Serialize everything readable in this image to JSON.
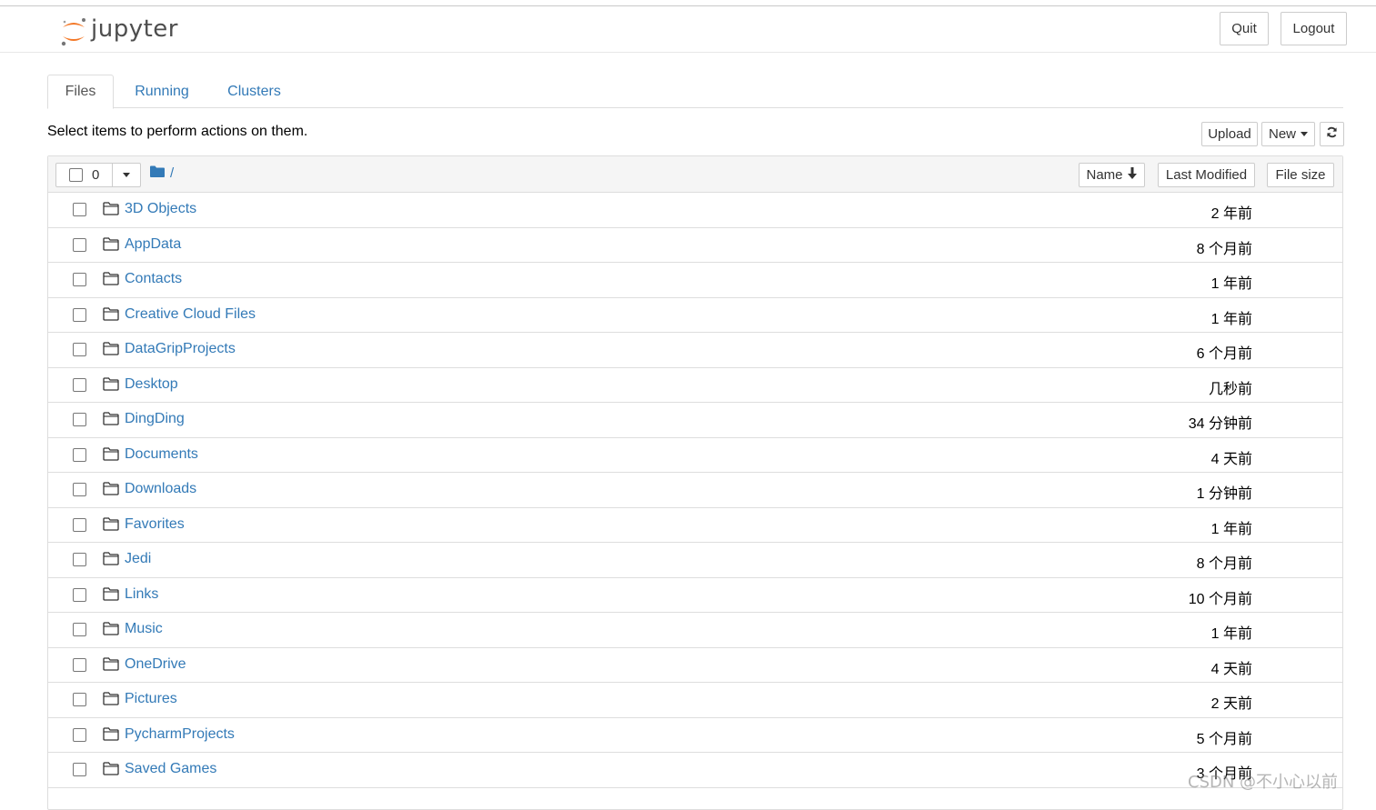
{
  "app": {
    "logo_text": "jupyter",
    "quit_label": "Quit",
    "logout_label": "Logout"
  },
  "tabs": [
    {
      "label": "Files"
    },
    {
      "label": "Running"
    },
    {
      "label": "Clusters"
    }
  ],
  "toolbar": {
    "hint": "Select items to perform actions on them.",
    "upload_label": "Upload",
    "new_label": "New"
  },
  "list": {
    "selected_count": "0",
    "breadcrumb": "/",
    "sort_name": "Name",
    "sort_modified": "Last Modified",
    "sort_size": "File size",
    "items": [
      {
        "name": "3D Objects",
        "modified": "2 年前"
      },
      {
        "name": "AppData",
        "modified": "8 个月前"
      },
      {
        "name": "Contacts",
        "modified": "1 年前"
      },
      {
        "name": "Creative Cloud Files",
        "modified": "1 年前"
      },
      {
        "name": "DataGripProjects",
        "modified": "6 个月前"
      },
      {
        "name": "Desktop",
        "modified": "几秒前"
      },
      {
        "name": "DingDing",
        "modified": "34 分钟前"
      },
      {
        "name": "Documents",
        "modified": "4 天前"
      },
      {
        "name": "Downloads",
        "modified": "1 分钟前"
      },
      {
        "name": "Favorites",
        "modified": "1 年前"
      },
      {
        "name": "Jedi",
        "modified": "8 个月前"
      },
      {
        "name": "Links",
        "modified": "10 个月前"
      },
      {
        "name": "Music",
        "modified": "1 年前"
      },
      {
        "name": "OneDrive",
        "modified": "4 天前"
      },
      {
        "name": "Pictures",
        "modified": "2 天前"
      },
      {
        "name": "PycharmProjects",
        "modified": "5 个月前"
      },
      {
        "name": "Saved Games",
        "modified": "3 个月前"
      }
    ]
  },
  "watermark": "CSDN @不小心以前"
}
